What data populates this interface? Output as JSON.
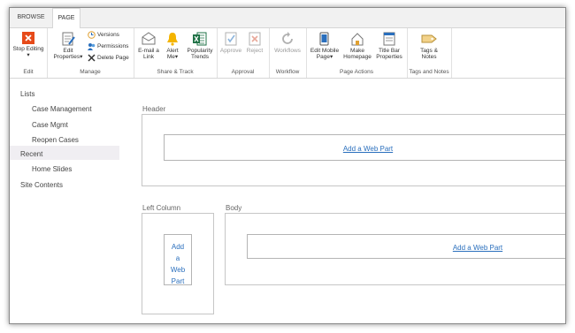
{
  "tabs": {
    "browse": "BROWSE",
    "page": "PAGE"
  },
  "ribbon": {
    "edit": {
      "title": "Edit",
      "stop_editing": "Stop Editing"
    },
    "manage": {
      "title": "Manage",
      "edit_properties_1": "Edit",
      "edit_properties_2": "Properties",
      "versions": "Versions",
      "permissions": "Permissions",
      "delete_page": "Delete Page"
    },
    "share": {
      "title": "Share & Track",
      "email_1": "E-mail a",
      "email_2": "Link",
      "alert_1": "Alert",
      "alert_2": "Me",
      "popularity_1": "Popularity",
      "popularity_2": "Trends"
    },
    "approval": {
      "title": "Approval",
      "approve": "Approve",
      "reject": "Reject"
    },
    "workflow": {
      "title": "Workflow",
      "workflows": "Workflows"
    },
    "page_actions": {
      "title": "Page Actions",
      "edit_mobile_1": "Edit Mobile",
      "edit_mobile_2": "Page",
      "make_home_1": "Make",
      "make_home_2": "Homepage",
      "title_bar_1": "Title Bar",
      "title_bar_2": "Properties"
    },
    "tags": {
      "title": "Tags and Notes",
      "tags_1": "Tags &",
      "tags_2": "Notes"
    }
  },
  "nav": {
    "lists": "Lists",
    "case_management": "Case Management",
    "case_mgmt": "Case Mgmt",
    "reopen_cases": "Reopen Cases",
    "recent": "Recent",
    "home_slides": "Home Slides",
    "site_contents": "Site Contents"
  },
  "zones": {
    "header_label": "Header",
    "left_column_label": "Left Column",
    "body_label": "Body",
    "add_web_part": "Add a Web Part",
    "left_add_1": "Add",
    "left_add_2": "a",
    "left_add_3": "Web",
    "left_add_4": "Part"
  },
  "colors": {
    "link": "#2a6fbd",
    "stop_editing": "#e64a19",
    "excel": "#1e7145"
  }
}
